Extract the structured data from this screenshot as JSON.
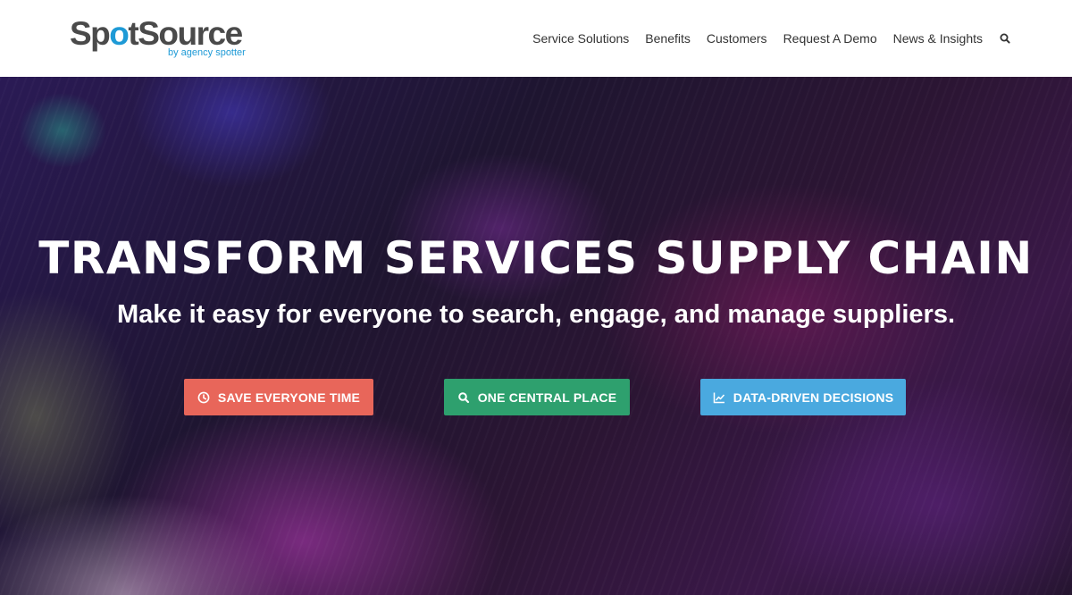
{
  "brand": {
    "logo_part1": "Sp",
    "logo_accent": "o",
    "logo_part2": "tSource",
    "tagline": "by agency spotter",
    "accent_color": "#1e9ad6"
  },
  "nav": {
    "items": [
      "Service Solutions",
      "Benefits",
      "Customers",
      "Request A Demo",
      "News & Insights"
    ],
    "search_icon": "search-icon"
  },
  "hero": {
    "title": "TRANSFORM SERVICES SUPPLY CHAIN",
    "subtitle": "Make it easy for everyone to search, engage, and manage suppliers.",
    "buttons": [
      {
        "label": "SAVE EVERYONE TIME",
        "icon": "clock-icon",
        "color": "#e8665a"
      },
      {
        "label": "ONE CENTRAL PLACE",
        "icon": "search-icon",
        "color": "#2ea06e"
      },
      {
        "label": "DATA-DRIVEN DECISIONS",
        "icon": "line-chart-icon",
        "color": "#4aa9df"
      }
    ]
  }
}
